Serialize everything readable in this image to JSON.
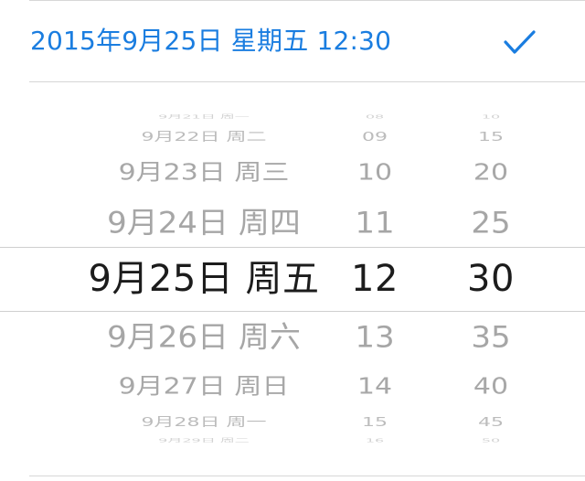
{
  "header": {
    "title": "2015年9月25日 星期五 12:30",
    "confirm_icon": "checkmark-icon",
    "accent_color": "#1a7de0"
  },
  "picker": {
    "days": [
      "9月21日 周一",
      "9月22日 周二",
      "9月23日 周三",
      "9月24日 周四",
      "9月25日 周五",
      "9月26日 周六",
      "9月27日 周日",
      "9月28日 周一",
      "9月29日 周二"
    ],
    "hours": [
      "08",
      "09",
      "10",
      "11",
      "12",
      "13",
      "14",
      "15",
      "16"
    ],
    "minutes": [
      "10",
      "15",
      "20",
      "25",
      "30",
      "35",
      "40",
      "45",
      "50"
    ],
    "selected_index": 4
  }
}
